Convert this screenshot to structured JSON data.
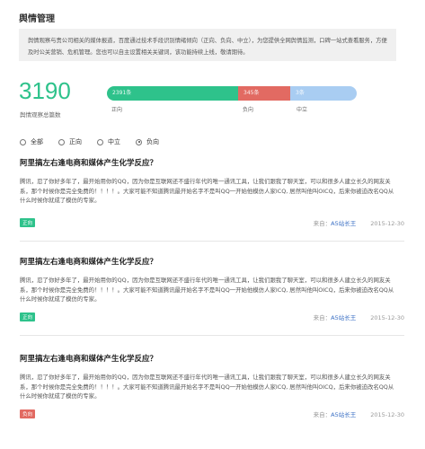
{
  "header": {
    "title": "舆情管理"
  },
  "notice": {
    "text": "舆情观察与贵公司相关的媒体报道，百度通过技术手段识别情绪倾向（正向、负向、中立），为您提供全网舆情监测，口碑一站式查看服务，方便及时公关营销、危机管理。您也可以自主设置相关关键词，该功能持续上线，敬请期待。"
  },
  "summary": {
    "total": "3190",
    "total_label": "舆情观察总篇数",
    "positive": {
      "count_label": "2391条",
      "label": "正向",
      "value": 2391
    },
    "negative": {
      "count_label": "345条",
      "label": "负向",
      "value": 345
    },
    "neutral": {
      "count_label": "3条",
      "label": "中立",
      "value": 3
    }
  },
  "colors": {
    "positive": "#2ec28b",
    "negative": "#e26a62",
    "neutral": "#a9cdf2",
    "link": "#3a6fc4"
  },
  "filters": {
    "selected": "负向",
    "options": [
      {
        "label": "全部"
      },
      {
        "label": "正向"
      },
      {
        "label": "中立"
      },
      {
        "label": "负向"
      }
    ]
  },
  "articles": [
    {
      "title": "阿里搞左右逢电商和媒体产生化学反应？",
      "body": "腾讯，忍了你好多年了，最开始用你的QQ，因为你是互联网还不盛行年代的唯一通讯工具，让我们跟我了聊天室，可以和很多人建立长久的网友关系，那个时候你是完全免费的！！！！。大家可能不知道腾讯最开始名字不是叫QQ一开始他模仿人家ICQ, 居然叫他叫OICQ，后来你被迫改名QQ从什么时候你就成了模仿的专家。",
      "source_prefix": "来自：",
      "source": "A5站长王",
      "date": "2015-12-30",
      "sentiment": "正向",
      "badge_color": "#2ec28b"
    },
    {
      "title": "阿里搞左右逢电商和媒体产生化学反应？",
      "body": "腾讯，忍了你好多年了，最开始用你的QQ，因为你是互联网还不盛行年代的唯一通讯工具，让我们跟我了聊天室，可以和很多人建立长久的网友关系，那个时候你是完全免费的！！！！。大家可能不知道腾讯最开始名字不是叫QQ一开始他模仿人家ICQ, 居然叫他叫OICQ，后来你被迫改名QQ从什么时候你就成了模仿的专家。",
      "source_prefix": "来自：",
      "source": "A5站长王",
      "date": "2015-12-30",
      "sentiment": "正向",
      "badge_color": "#2ec28b"
    },
    {
      "title": "阿里搞左右逢电商和媒体产生化学反应？",
      "body": "腾讯，忍了你好多年了，最开始用你的QQ，因为你是互联网还不盛行年代的唯一通讯工具，让我们跟我了聊天室，可以和很多人建立长久的网友关系，那个时候你是完全免费的！！！！。大家可能不知道腾讯最开始名字不是叫QQ一开始他模仿人家ICQ, 居然叫他叫OICQ，后来你被迫改名QQ从什么时候你就成了模仿的专家。",
      "source_prefix": "来自：",
      "source": "A5站长王",
      "date": "2015-12-30",
      "sentiment": "负向",
      "badge_color": "#e26a62"
    }
  ]
}
